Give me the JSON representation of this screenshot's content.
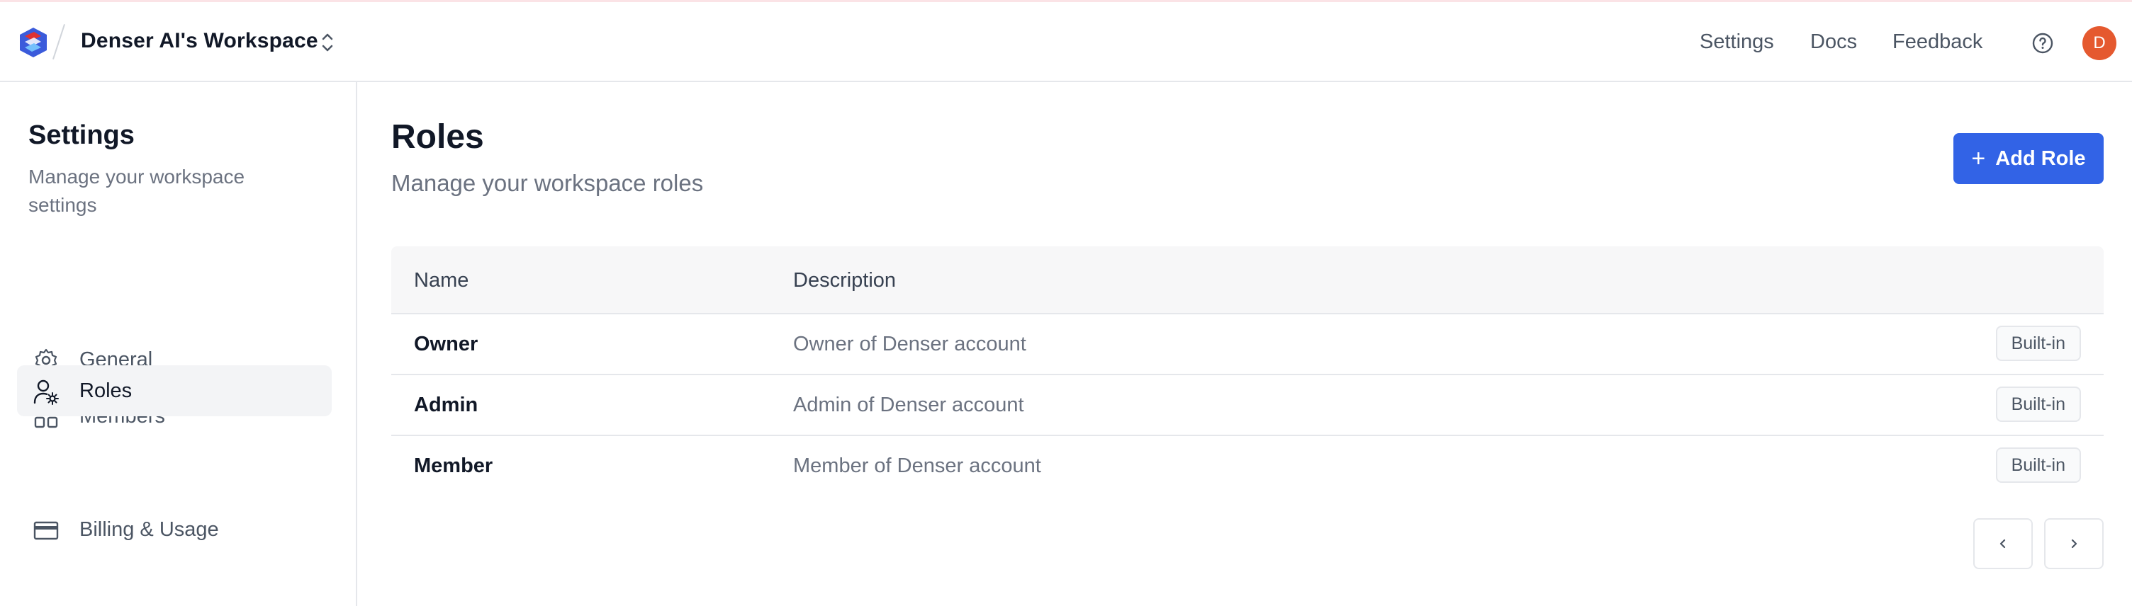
{
  "header": {
    "workspace_name": "Denser AI's Workspace",
    "nav": [
      "Settings",
      "Docs",
      "Feedback"
    ],
    "avatar_initial": "D"
  },
  "sidebar": {
    "title": "Settings",
    "subtitle": "Manage your workspace settings",
    "items": [
      {
        "label": "General",
        "icon": "gear-icon"
      },
      {
        "label": "Members",
        "icon": "grid-users-icon"
      },
      {
        "label": "Roles",
        "icon": "user-cog-icon",
        "active": true
      },
      {
        "label": "Billing & Usage",
        "icon": "credit-card-icon"
      }
    ]
  },
  "main": {
    "title": "Roles",
    "subtitle": "Manage your workspace roles",
    "add_button": "Add Role",
    "table": {
      "columns": [
        "Name",
        "Description"
      ],
      "rows": [
        {
          "name": "Owner",
          "description": "Owner of Denser account",
          "badge": "Built-in"
        },
        {
          "name": "Admin",
          "description": "Admin of Denser account",
          "badge": "Built-in"
        },
        {
          "name": "Member",
          "description": "Member of Denser account",
          "badge": "Built-in"
        }
      ]
    }
  },
  "colors": {
    "accent": "#3263e6",
    "avatar": "#e5592f"
  }
}
